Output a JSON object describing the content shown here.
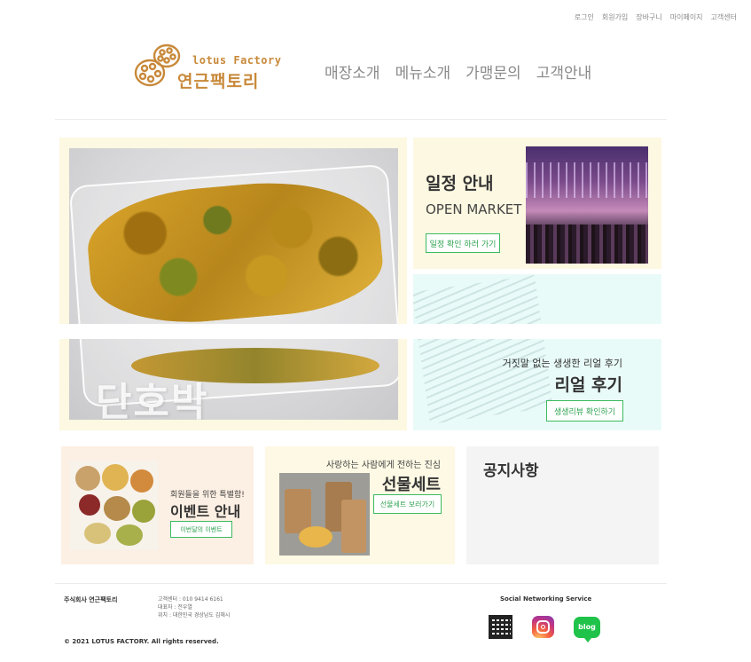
{
  "util_nav": [
    "로그인",
    "회원가입",
    "장바구니",
    "마이페이지",
    "고객센터"
  ],
  "logo": {
    "en": "lotus Factory",
    "ko": "연근팩토리",
    "icon": "lotus-root-icon",
    "color": "#c8893a"
  },
  "main_nav": [
    "매장소개",
    "메뉴소개",
    "가맹문의",
    "고객안내"
  ],
  "hero": {
    "product_label": "단호박"
  },
  "schedule": {
    "title": "일정 안내",
    "subtitle": "OPEN MARKET",
    "button": "일정 확인 하러 가기"
  },
  "review": {
    "subtitle": "거짓말 없는 생생한 리얼 후기",
    "title": "리얼 후기",
    "button": "생생리뷰 확인하기"
  },
  "event": {
    "subtitle": "회원들을 위한 특별함!",
    "title": "이벤트 안내",
    "button": "이번달의 이벤트"
  },
  "gift": {
    "subtitle": "사랑하는 사람에게 전하는 진심",
    "title": "선물세트",
    "button": "선물세트 보러가기"
  },
  "notice": {
    "title": "공지사항"
  },
  "footer": {
    "company": "주식회사 연근팩토리",
    "info": [
      "고객센터 : 010 9414 6161",
      "대표자 : 전우열",
      "위치 : 대한민국 경상남도 김해시"
    ],
    "copyright": "© 2021 LOTUS FACTORY. All rights reserved.",
    "sns_title": "Social Networking Service",
    "sns": [
      {
        "name": "qr-code-icon"
      },
      {
        "name": "instagram-icon"
      },
      {
        "name": "blog-icon",
        "label": "blog"
      }
    ]
  },
  "colors": {
    "accent_green": "#3cba5f",
    "brand_gold": "#c8893a"
  }
}
